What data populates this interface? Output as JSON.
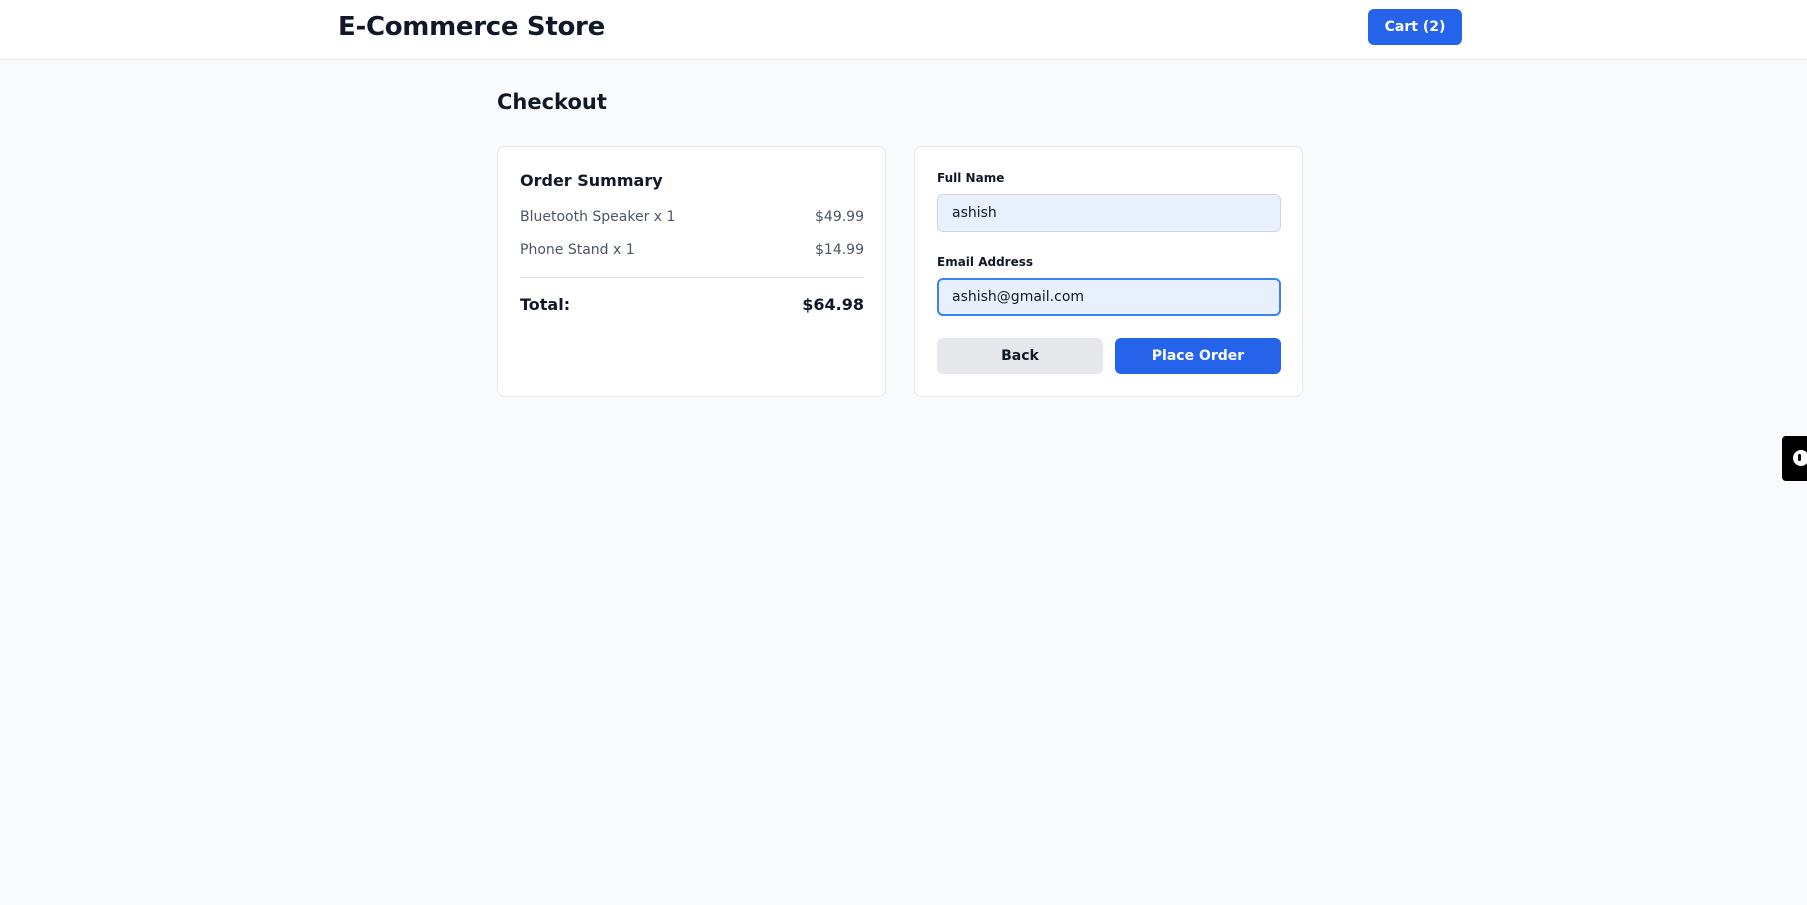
{
  "header": {
    "brand": "E-Commerce Store",
    "cart_label": "Cart (2)"
  },
  "page": {
    "title": "Checkout"
  },
  "summary": {
    "title": "Order Summary",
    "items": [
      {
        "name": "Bluetooth Speaker x 1",
        "price": "$49.99"
      },
      {
        "name": "Phone Stand x 1",
        "price": "$14.99"
      }
    ],
    "total_label": "Total:",
    "total_value": "$64.98"
  },
  "form": {
    "full_name_label": "Full Name",
    "full_name_value": "ashish",
    "email_label": "Email Address",
    "email_value": "ashish@gmail.com",
    "back_label": "Back",
    "place_order_label": "Place Order"
  },
  "colors": {
    "accent": "#2563eb",
    "background": "#f8fafc",
    "input_fill": "#e8f0fe",
    "focus_ring": "#3b82f6"
  },
  "icons": {
    "side_widget": "feedback-widget-icon"
  }
}
